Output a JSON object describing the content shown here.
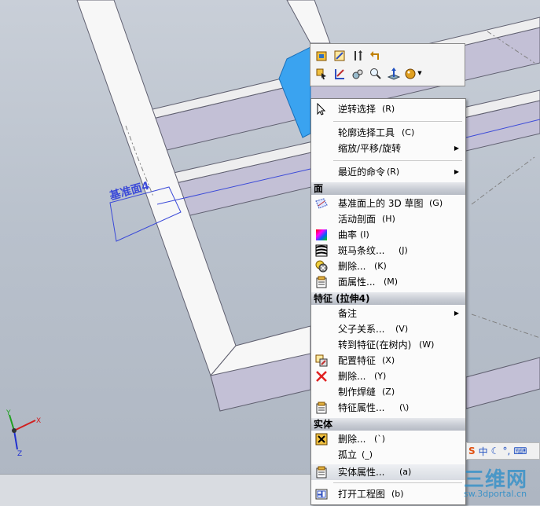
{
  "plane_label": "基准面4",
  "toolbar": {
    "row1_icons": [
      "feature-tree-icon",
      "edit-sketch-icon",
      "rollback-icon",
      "undo-icon"
    ],
    "row2_icons": [
      "select-other-icon",
      "sketch-icon",
      "view-orientation-icon",
      "zoom-to-selection-icon",
      "normal-to-icon",
      "appearance-icon"
    ]
  },
  "menu": {
    "reverse_select": {
      "label": "逆转选择",
      "key": "(R)"
    },
    "profile_tool": {
      "label": "轮廓选择工具",
      "key": "(C)"
    },
    "zoom_pan_rotate": {
      "label": "缩放/平移/旋转"
    },
    "recent_commands": {
      "label": "最近的命令",
      "key": "(R)"
    },
    "section_face": "面",
    "sketch_on_plane": {
      "label": "基准面上的 3D 草图",
      "key": "(G)"
    },
    "live_section": {
      "label": "活动剖面",
      "key": "(H)"
    },
    "curvature": {
      "label": "曲率",
      "key": "(I)"
    },
    "zebra": {
      "label": "斑马条纹...",
      "key": "(J)"
    },
    "delete_face": {
      "label": "删除...",
      "key": "(K)"
    },
    "face_props": {
      "label": "面属性...",
      "key": "(M)"
    },
    "section_feature": "特征 (拉伸4)",
    "annotations": {
      "label": "备注"
    },
    "parent_child": {
      "label": "父子关系...",
      "key": "(V)"
    },
    "goto_feature": {
      "label": "转到特征(在树内)",
      "key": "(W)"
    },
    "config_feature": {
      "label": "配置特征",
      "key": "(X)"
    },
    "delete_feature": {
      "label": "删除...",
      "key": "(Y)"
    },
    "make_weld": {
      "label": "制作焊缝",
      "key": "(Z)"
    },
    "feature_props": {
      "label": "特征属性...",
      "key": "(\\)"
    },
    "section_body": "实体",
    "delete_body": {
      "label": "删除...",
      "key": "(`)"
    },
    "isolate": {
      "label": "孤立",
      "key": "(_)"
    },
    "body_props": {
      "label": "实体属性...",
      "key": "(a)"
    },
    "open_drawing": {
      "label": "打开工程图",
      "key": "(b)"
    }
  },
  "ime": {
    "lang": "中"
  },
  "watermark": {
    "title": "三维网",
    "url": "sw.3dportal.cn"
  },
  "colors": {
    "highlight_face": "#3aa3f0",
    "plane": "#3b4ad8",
    "menu_bg": "#fbfbfb"
  }
}
